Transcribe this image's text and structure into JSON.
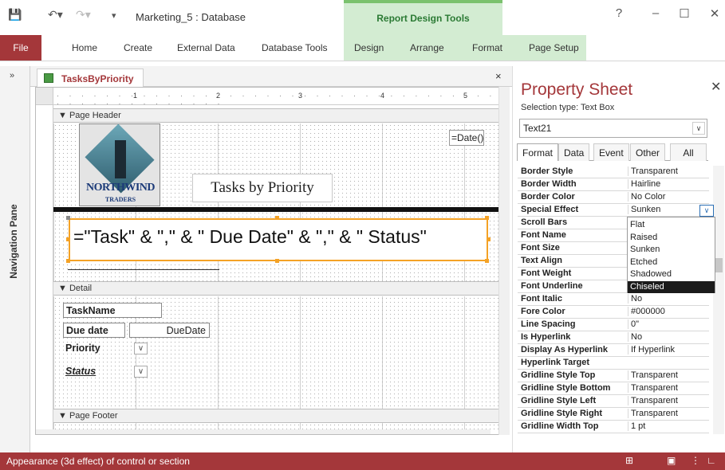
{
  "app": {
    "doc_title": "Marketing_5 : Database",
    "context_group": "Report Design Tools",
    "help": "?",
    "colors": {
      "accent": "#a4373a",
      "context": "#2b7a34",
      "context_bg": "#d3ecd2"
    }
  },
  "ribbon": {
    "file": "File",
    "tabs": [
      "Home",
      "Create",
      "External Data",
      "Database Tools"
    ],
    "context_tabs": [
      "Design",
      "Arrange",
      "Format",
      "Page Setup"
    ]
  },
  "nav": {
    "label": "Navigation Pane",
    "toggle": "»"
  },
  "document": {
    "tab_label": "TasksByPriority",
    "close": "×",
    "ruler_ticks": [
      "1",
      "2",
      "3",
      "4",
      "5"
    ],
    "sections": {
      "page_header": "Page Header",
      "detail": "Detail",
      "page_footer": "Page Footer"
    },
    "logo_text": "NORTHWIND",
    "logo_sub": "TRADERS",
    "report_title": "Tasks by Priority",
    "date_field": "=Date()",
    "selected_control": "=\"Task\" & \",\" & \" Due Date\" & \",\" & \" Status\"",
    "fields": {
      "taskname": "TaskName",
      "due_label": "Due date",
      "due_value": "DueDate",
      "priority": "Priority",
      "status": "Status"
    }
  },
  "property_sheet": {
    "title": "Property Sheet",
    "selection_type": "Selection type:  Text Box",
    "selected_object": "Text21",
    "tabs": [
      "Format",
      "Data",
      "Event",
      "Other",
      "All"
    ],
    "active_tab": "Format",
    "rows": [
      {
        "name": "Border Style",
        "value": "Transparent"
      },
      {
        "name": "Border Width",
        "value": "Hairline"
      },
      {
        "name": "Border Color",
        "value": "No Color"
      },
      {
        "name": "Special Effect",
        "value": "Sunken"
      },
      {
        "name": "Scroll Bars",
        "value": ""
      },
      {
        "name": "Font Name",
        "value": ""
      },
      {
        "name": "Font Size",
        "value": ""
      },
      {
        "name": "Text Align",
        "value": ""
      },
      {
        "name": "Font Weight",
        "value": ""
      },
      {
        "name": "Font Underline",
        "value": ""
      },
      {
        "name": "Font Italic",
        "value": "No"
      },
      {
        "name": "Fore Color",
        "value": "#000000"
      },
      {
        "name": "Line Spacing",
        "value": "0\""
      },
      {
        "name": "Is Hyperlink",
        "value": "No"
      },
      {
        "name": "Display As Hyperlink",
        "value": "If Hyperlink"
      },
      {
        "name": "Hyperlink Target",
        "value": ""
      },
      {
        "name": "Gridline Style Top",
        "value": "Transparent"
      },
      {
        "name": "Gridline Style Bottom",
        "value": "Transparent"
      },
      {
        "name": "Gridline Style Left",
        "value": "Transparent"
      },
      {
        "name": "Gridline Style Right",
        "value": "Transparent"
      },
      {
        "name": "Gridline Width Top",
        "value": "1 pt"
      }
    ],
    "dropdown": {
      "options": [
        "Flat",
        "Raised",
        "Sunken",
        "Etched",
        "Shadowed",
        "Chiseled"
      ],
      "highlighted": "Chiseled"
    }
  },
  "status": {
    "text": "Appearance (3d effect) of control or section"
  }
}
